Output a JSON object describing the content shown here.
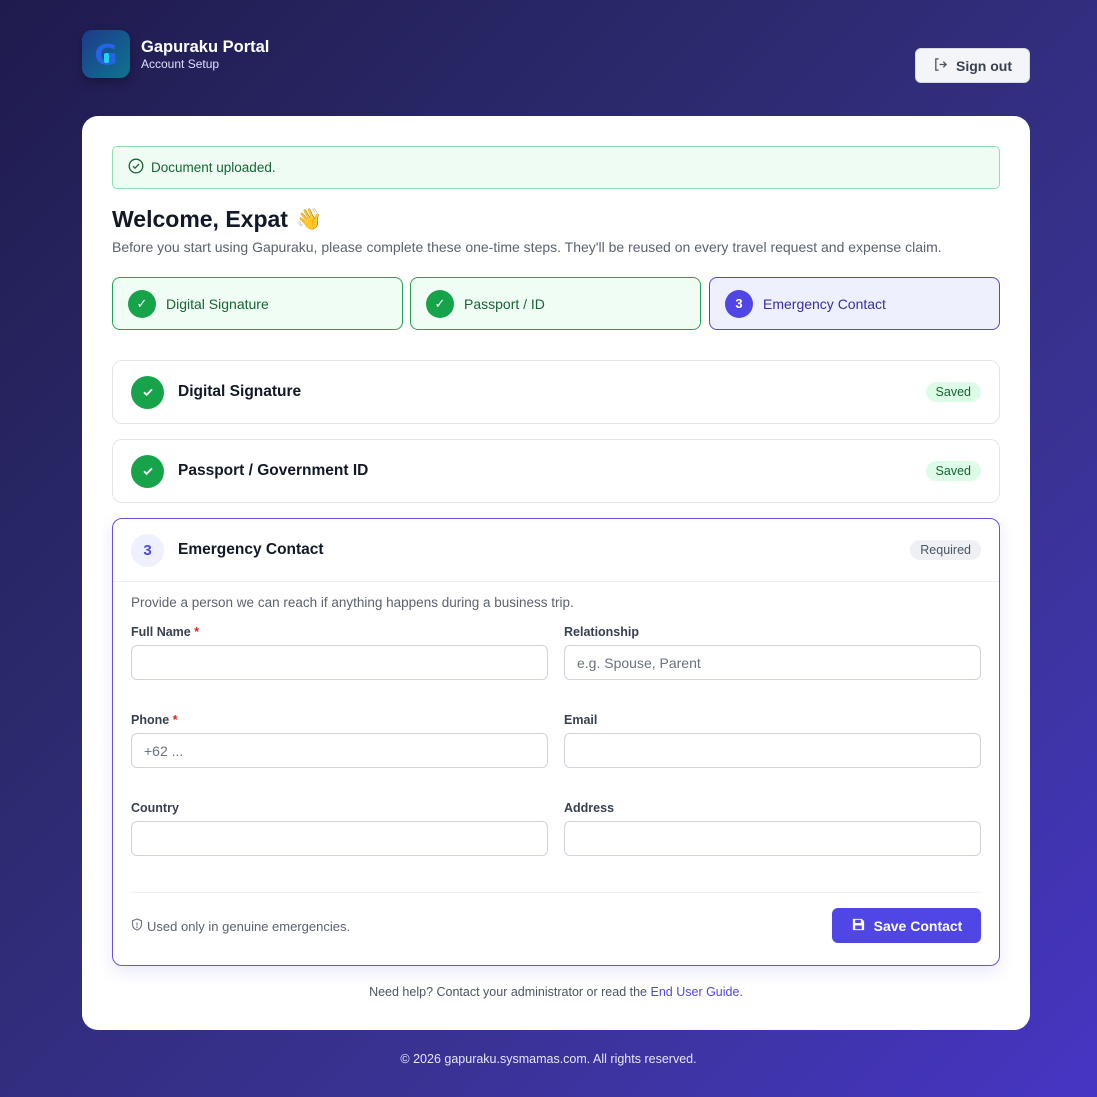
{
  "header": {
    "brand_title": "Gapuraku Portal",
    "brand_subtitle": "Account Setup",
    "logo_icon": "gapuraku-logo-icon",
    "sign_out_label": "Sign out"
  },
  "alert": {
    "message": "Document uploaded.",
    "icon": "check-circle-icon"
  },
  "welcome": {
    "title": "Welcome, Expat",
    "emoji": "👋",
    "intro": "Before you start using Gapuraku, please complete these one-time steps. They'll be reused on every travel request and expense claim."
  },
  "steps": [
    {
      "label": "Digital Signature",
      "status": "done",
      "marker": "✓"
    },
    {
      "label": "Passport / ID",
      "status": "done",
      "marker": "✓"
    },
    {
      "label": "Emergency Contact",
      "status": "active",
      "marker": "3"
    }
  ],
  "panels": {
    "signature": {
      "title": "Digital Signature",
      "badge": "Saved"
    },
    "passport": {
      "title": "Passport / Government ID",
      "badge": "Saved"
    },
    "emergency": {
      "number": "3",
      "title": "Emergency Contact",
      "badge": "Required",
      "description": "Provide a person we can reach if anything happens during a business trip.",
      "fields": {
        "full_name": {
          "label": "Full Name",
          "required": "*",
          "value": "",
          "placeholder": ""
        },
        "relationship": {
          "label": "Relationship",
          "value": "",
          "placeholder": "e.g. Spouse, Parent"
        },
        "phone": {
          "label": "Phone",
          "required": "*",
          "value": "",
          "placeholder": "+62 ..."
        },
        "email": {
          "label": "Email",
          "value": "",
          "placeholder": ""
        },
        "country": {
          "label": "Country",
          "value": "",
          "placeholder": ""
        },
        "address": {
          "label": "Address",
          "value": "",
          "placeholder": ""
        }
      },
      "footnote": "Used only in genuine emergencies.",
      "save_label": "Save Contact"
    }
  },
  "help": {
    "text": "Need help? Contact your administrator or read the",
    "link": "End User Guide",
    "suffix": "."
  },
  "footer": {
    "copyright": "© 2026 gapuraku.sysmamas.com. All rights reserved."
  },
  "colors": {
    "accent": "#4f46e5",
    "success": "#16a34a",
    "required": "#dc2626"
  }
}
